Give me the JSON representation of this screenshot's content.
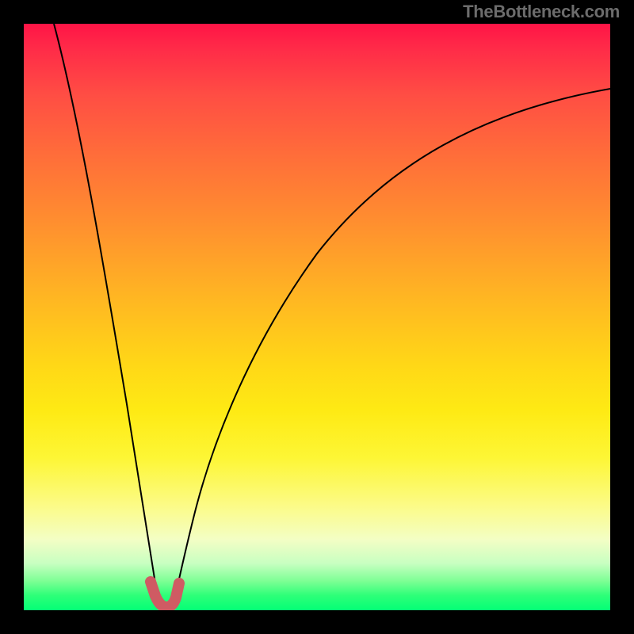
{
  "attribution": "TheBottleneck.com",
  "chart_data": {
    "type": "line",
    "title": "",
    "xlabel": "",
    "ylabel": "",
    "xlim": [
      0,
      100
    ],
    "ylim": [
      0,
      100
    ],
    "series": [
      {
        "name": "left-curve",
        "x": [
          5,
          8,
          10,
          12,
          14,
          16,
          18,
          19,
          20,
          21,
          22
        ],
        "values": [
          100,
          85,
          74,
          62,
          49,
          35,
          20,
          12,
          6,
          2,
          0
        ]
      },
      {
        "name": "right-curve",
        "x": [
          24,
          25,
          27,
          30,
          34,
          40,
          48,
          58,
          70,
          84,
          100
        ],
        "values": [
          0,
          5,
          15,
          28,
          40,
          53,
          64,
          73,
          80,
          85,
          88
        ]
      }
    ],
    "annotations": [
      {
        "name": "optimum-marker",
        "x_range": [
          20.5,
          25.5
        ],
        "y": 0,
        "color": "#cf5b63"
      }
    ],
    "gradient_colors": {
      "top": "#ff1446",
      "mid": "#ffd717",
      "bottom": "#04ff76"
    }
  }
}
